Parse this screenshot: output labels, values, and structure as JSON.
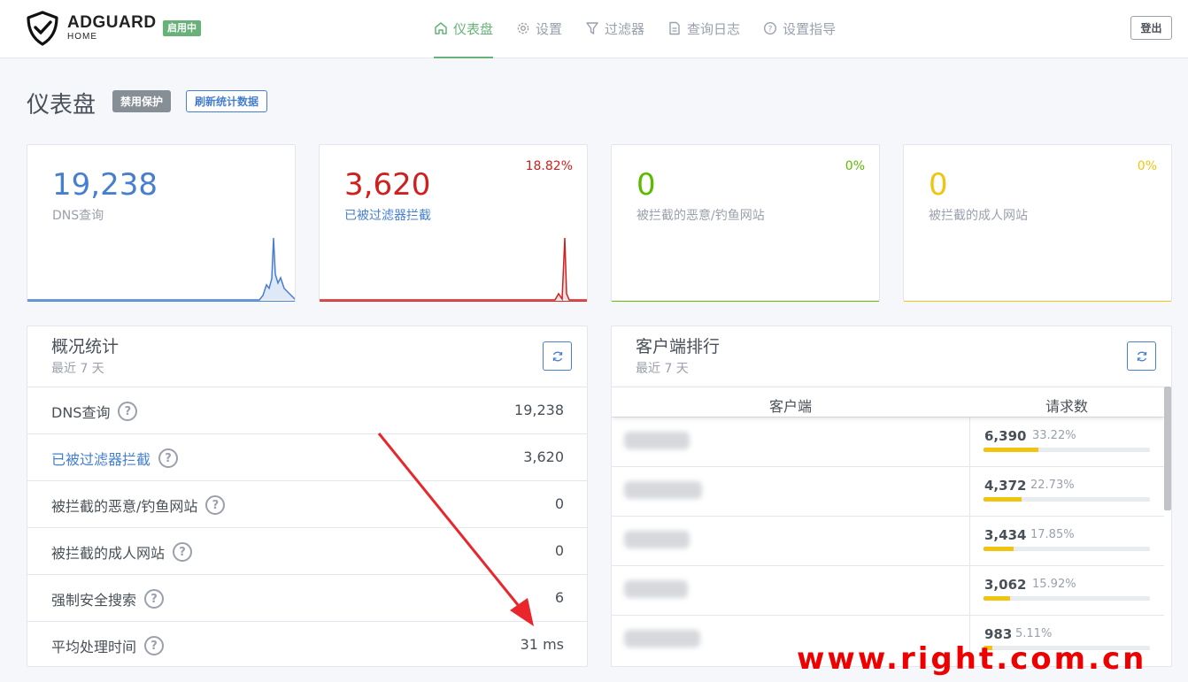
{
  "brand": {
    "name": "ADGUARD",
    "sub": "HOME",
    "status": "启用中"
  },
  "nav": [
    {
      "label": "仪表盘",
      "icon": "home-icon",
      "active": true
    },
    {
      "label": "设置",
      "icon": "gear-icon",
      "active": false
    },
    {
      "label": "过滤器",
      "icon": "filter-icon",
      "active": false
    },
    {
      "label": "查询日志",
      "icon": "document-icon",
      "active": false
    },
    {
      "label": "设置指导",
      "icon": "help-icon",
      "active": false
    }
  ],
  "logout": "登出",
  "page": {
    "title": "仪表盘",
    "disable_btn": "禁用保护",
    "refresh_btn": "刷新统计数据"
  },
  "stats": [
    {
      "value": "19,238",
      "label": "DNS查询",
      "pct": "",
      "color": "#467fcf"
    },
    {
      "value": "3,620",
      "label": "已被过滤器拦截",
      "pct": "18.82%",
      "color": "#cd201f"
    },
    {
      "value": "0",
      "label": "被拦截的恶意/钓鱼网站",
      "pct": "0%",
      "color": "#5eba00"
    },
    {
      "value": "0",
      "label": "被拦截的成人网站",
      "pct": "0%",
      "color": "#f1c40f"
    }
  ],
  "overview": {
    "title": "概况统计",
    "subtitle": "最近 7 天",
    "rows": [
      {
        "label": "DNS查询",
        "value": "19,238"
      },
      {
        "label": "已被过滤器拦截",
        "value": "3,620"
      },
      {
        "label": "被拦截的恶意/钓鱼网站",
        "value": "0"
      },
      {
        "label": "被拦截的成人网站",
        "value": "0"
      },
      {
        "label": "强制安全搜索",
        "value": "6"
      },
      {
        "label": "平均处理时间",
        "value": "31 ms"
      }
    ]
  },
  "clients": {
    "title": "客户端排行",
    "subtitle": "最近 7 天",
    "col_client": "客户端",
    "col_requests": "请求数",
    "rows": [
      {
        "count": "6,390",
        "pct": "33.22%",
        "share": 0.3322
      },
      {
        "count": "4,372",
        "pct": "22.73%",
        "share": 0.2273
      },
      {
        "count": "3,434",
        "pct": "17.85%",
        "share": 0.1785
      },
      {
        "count": "3,062",
        "pct": "15.92%",
        "share": 0.1592
      },
      {
        "count": "983",
        "pct": "5.11%",
        "share": 0.0511
      }
    ]
  },
  "watermark": "www.right.com.cn"
}
